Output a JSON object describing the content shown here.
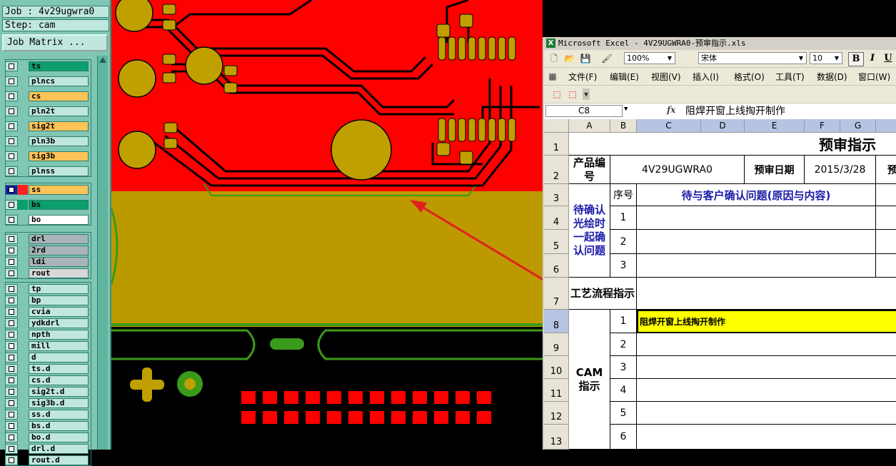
{
  "left_panel": {
    "job": "Job : 4v29ugwra0",
    "step": "Step: cam",
    "matrix_button": "Job Matrix ...",
    "layers": [
      {
        "name": "ts",
        "color": "#0c9e6c"
      },
      {
        "name": "plncs",
        "color": "#bfe7dd"
      },
      {
        "name": "cs",
        "color": "#ffc457"
      },
      {
        "name": "pln2t",
        "color": "#bfe7dd"
      },
      {
        "name": "sig2t",
        "color": "#ffc457"
      },
      {
        "name": "pln3b",
        "color": "#bfe7dd"
      },
      {
        "name": "sig3b",
        "color": "#ffc457"
      },
      {
        "name": "plnss",
        "color": "#bfe7dd"
      },
      {
        "name": "ss",
        "color": "#ffc457"
      },
      {
        "name": "bs",
        "color": "#0c9e6c"
      },
      {
        "name": "bo",
        "color": "#ffffff"
      },
      {
        "name": "drl",
        "color": "#a8b4b8"
      },
      {
        "name": "2rd",
        "color": "#a8b4b8"
      },
      {
        "name": "ldi",
        "color": "#a8b4b8"
      },
      {
        "name": "rout",
        "color": "#d8d8d8"
      },
      {
        "name": "tp",
        "color": "#bfe7dd"
      },
      {
        "name": "bp",
        "color": "#bfe7dd"
      },
      {
        "name": "cvia",
        "color": "#bfe7dd"
      },
      {
        "name": "ydkdrl",
        "color": "#bfe7dd"
      },
      {
        "name": "npth",
        "color": "#bfe7dd"
      },
      {
        "name": "mill",
        "color": "#bfe7dd"
      },
      {
        "name": "d",
        "color": "#bfe7dd"
      },
      {
        "name": "ts.d",
        "color": "#bfe7dd"
      },
      {
        "name": "cs.d",
        "color": "#bfe7dd"
      },
      {
        "name": "sig2t.d",
        "color": "#bfe7dd"
      },
      {
        "name": "sig3b.d",
        "color": "#bfe7dd"
      },
      {
        "name": "ss.d",
        "color": "#bfe7dd"
      },
      {
        "name": "bs.d",
        "color": "#bfe7dd"
      },
      {
        "name": "bo.d",
        "color": "#bfe7dd"
      },
      {
        "name": "drl.d",
        "color": "#bfe7dd"
      },
      {
        "name": "rout.d",
        "color": "#bfe7dd"
      }
    ]
  },
  "excel": {
    "title": "Microsoft Excel - 4V29UGWRA0-预审指示.xls",
    "zoom": "100%",
    "font_name": "宋体",
    "font_size": "10",
    "bold": "B",
    "italic": "I",
    "underline": "U",
    "menu": [
      "文件(F)",
      "编辑(E)",
      "视图(V)",
      "插入(I)",
      "格式(O)",
      "工具(T)",
      "数据(D)",
      "窗口(W)"
    ],
    "name_box": "C8",
    "fx": "fx",
    "formula": "阻焊开窗上线掏开制作",
    "columns": [
      "A",
      "B",
      "C",
      "D",
      "E",
      "F",
      "G"
    ],
    "rows": [
      "1",
      "2",
      "3",
      "4",
      "5",
      "6",
      "7",
      "8",
      "9",
      "10",
      "11",
      "12",
      "13"
    ],
    "title_cell": "预审指示",
    "product_no_label": "产品编号",
    "product_no": "4V29UGWRA0",
    "review_date_label": "预审日期",
    "review_date": "2015/3/28",
    "review_cut": "预",
    "seq_label": "序号",
    "issues_header": "待与客户确认问题(原因与内容)",
    "confirm_label": "待确认光绘时一起确认问题",
    "issue_nums": [
      "1",
      "2",
      "3"
    ],
    "process_label": "工艺流程指示",
    "cam_label": "CAM指示",
    "cam_nums": [
      "1",
      "2",
      "3",
      "4",
      "5",
      "6"
    ],
    "cam_item1": "阻焊开窗上线掏开制作"
  },
  "colors": {
    "board_red": "#ff0000",
    "board_gold": "#bd9900",
    "board_green": "#3a9a1a",
    "pad_gold": "#c0a000",
    "arrow": "#e02020",
    "cell_yellow": "#ffff00"
  }
}
